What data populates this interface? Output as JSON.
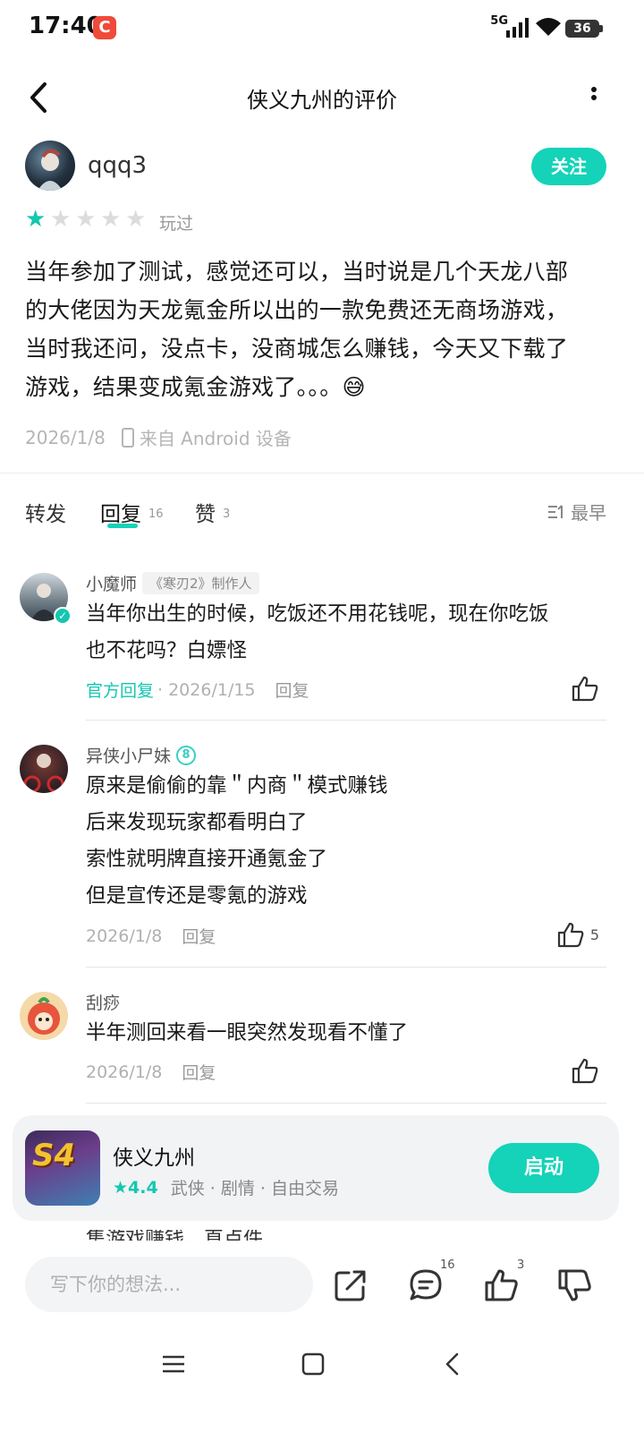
{
  "status_bar": {
    "time": "17:40",
    "app_badge": "C",
    "network": "5G",
    "battery": "36"
  },
  "header": {
    "title": "侠义九州的评价"
  },
  "review": {
    "author": "qqq3",
    "follow_label": "关注",
    "rating": 1,
    "max_rating": 5,
    "played_label": "玩过",
    "lines": [
      "当年参加了测试，感觉还可以，当时说是几个天龙八部",
      "的大佬因为天龙氪金所以出的一款免费还无商场游戏，",
      "当时我还问，没点卡，没商城怎么赚钱，今天又下载了",
      "游戏，结果变成氪金游戏了。。。😅"
    ],
    "date": "2026/1/8",
    "device": "来自 Android 设备"
  },
  "tabs": {
    "repost": "转发",
    "reply": "回复",
    "reply_count": "16",
    "like": "赞",
    "like_count": "3",
    "sort": "最早"
  },
  "comments": [
    {
      "name": "小魔师",
      "tag": "《寒刃2》制作人",
      "lines": [
        "当年你出生的时候，吃饭还不用花钱呢，现在你吃饭",
        "也不花吗？白嫖怪"
      ],
      "official": "官方回复",
      "date": "· 2026/1/15",
      "reply": "回复",
      "likes": ""
    },
    {
      "name": "异侠小尸妹",
      "level": "8",
      "lines": [
        "原来是偷偷的靠＂内商＂模式赚钱",
        "后来发现玩家都看明白了",
        "索性就明牌直接开通氪金了",
        "但是宣传还是零氪的游戏"
      ],
      "date": "2026/1/8",
      "reply": "回复",
      "likes": "5"
    },
    {
      "name": "刮痧",
      "lines": [
        "半年测回来看一眼突然发现看不懂了"
      ],
      "date": "2026/1/8",
      "reply": "回复",
      "likes": ""
    }
  ],
  "peek_text": "集游戏赚钱，直点件",
  "game_card": {
    "icon_text": "S4",
    "name": "侠义九州",
    "rating": "★4.4",
    "tags": "武侠 · 剧情 · 自由交易",
    "launch_label": "启动"
  },
  "bottom_bar": {
    "input_placeholder": "写下你的想法...",
    "comment_count": "16",
    "like_count": "3"
  },
  "colors": {
    "accent": "#14d3b8",
    "star_on": "#14c7b0",
    "star_off": "#dcdcdc"
  }
}
